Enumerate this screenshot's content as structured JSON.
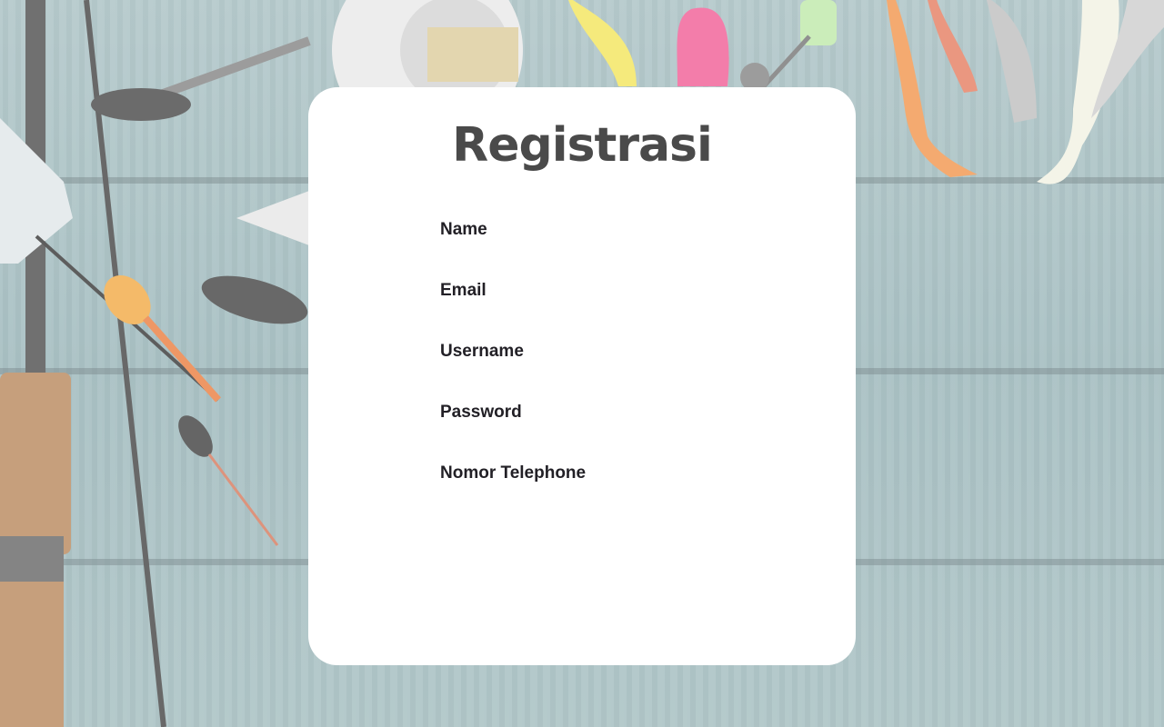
{
  "page": {
    "title": "Registrasi"
  },
  "form": {
    "fields": [
      {
        "label": "Name"
      },
      {
        "label": "Email"
      },
      {
        "label": "Username"
      },
      {
        "label": "Password"
      },
      {
        "label": "Nomor Telephone"
      }
    ]
  },
  "colors": {
    "card_background": "#ffffff",
    "title_text": "#4a4a4a",
    "label_text": "#222026",
    "background_wood": "#8fb0b3"
  },
  "background": {
    "description_icon": "fishing-gear-background"
  }
}
